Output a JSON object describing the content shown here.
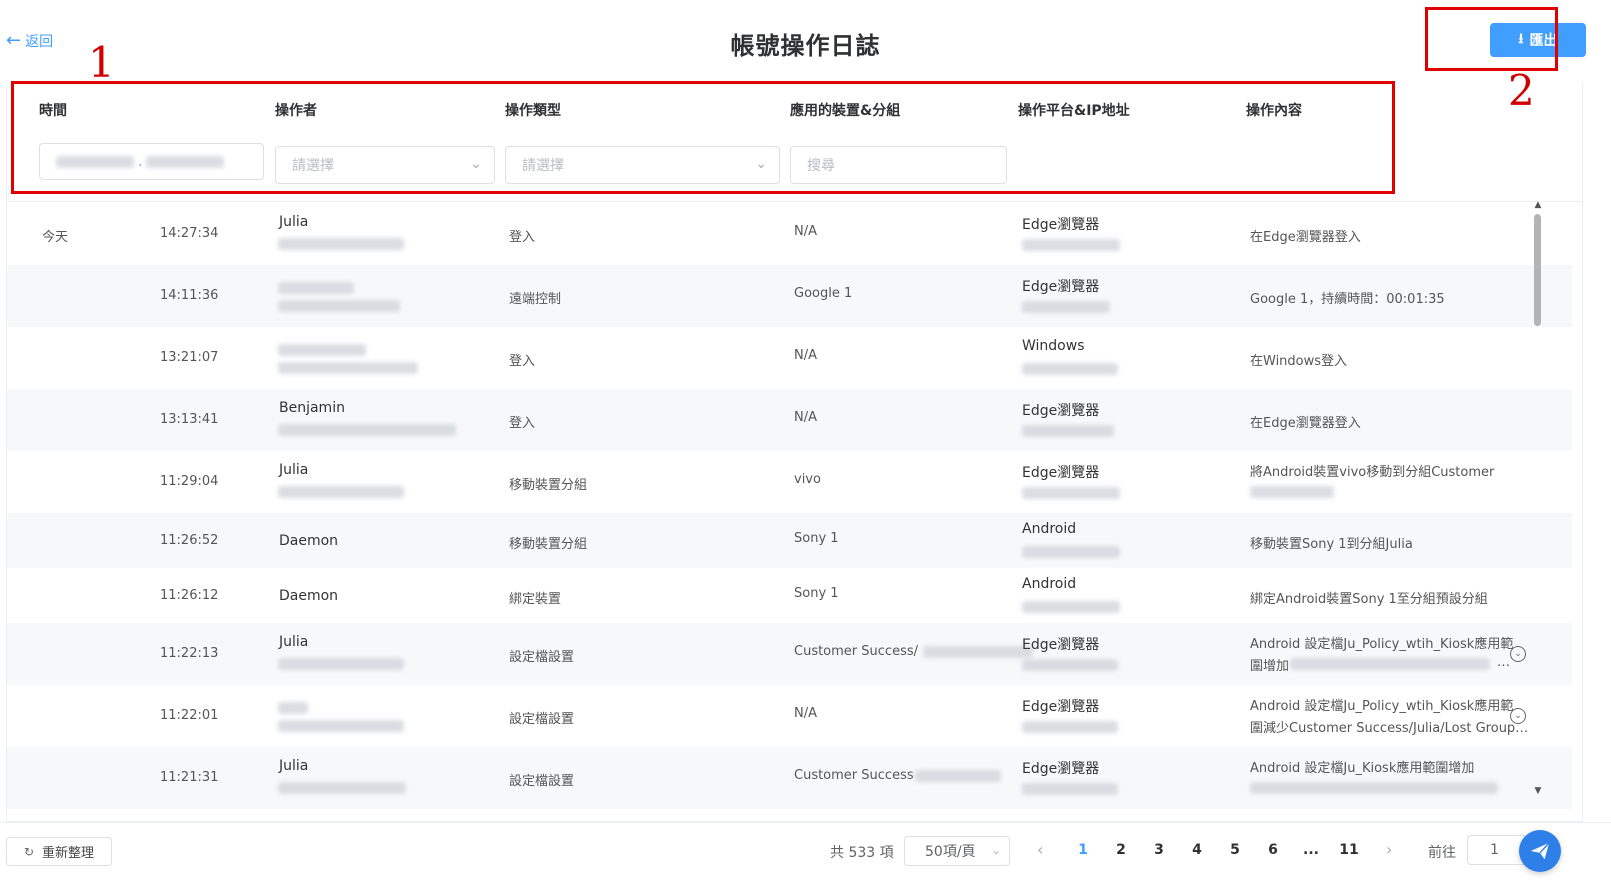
{
  "header": {
    "back_label": "返回",
    "title": "帳號操作日誌",
    "export_label": "匯出"
  },
  "annotations": [
    "1",
    "2"
  ],
  "columns": [
    "時間",
    "操作者",
    "操作類型",
    "應用的裝置&分組",
    "操作平台&IP地址",
    "操作內容"
  ],
  "filters": {
    "operator_placeholder": "請選擇",
    "type_placeholder": "請選擇",
    "search_placeholder": "搜尋"
  },
  "rows": [
    {
      "date": "今天",
      "time": "14:27:34",
      "operator": "Julia",
      "type": "登入",
      "device": "N/A",
      "platform": "Edge瀏覽器",
      "content": "在Edge瀏覽器登入"
    },
    {
      "date": "",
      "time": "14:11:36",
      "operator": "",
      "type": "遠端控制",
      "device": "Google 1",
      "platform": "Edge瀏覽器",
      "content": "Google 1，持續時間：00:01:35"
    },
    {
      "date": "",
      "time": "13:21:07",
      "operator": "",
      "type": "登入",
      "device": "N/A",
      "platform": "Windows",
      "content": "在Windows登入"
    },
    {
      "date": "",
      "time": "13:13:41",
      "operator": "Benjamin",
      "type": "登入",
      "device": "N/A",
      "platform": "Edge瀏覽器",
      "content": "在Edge瀏覽器登入"
    },
    {
      "date": "",
      "time": "11:29:04",
      "operator": "Julia",
      "type": "移動裝置分組",
      "device": "vivo",
      "platform": "Edge瀏覽器",
      "content": "將Android裝置vivo移動到分組Customer"
    },
    {
      "date": "",
      "time": "11:26:52",
      "operator": "Daemon",
      "type": "移動裝置分組",
      "device": "Sony 1",
      "platform": "Android",
      "content": "移動裝置Sony 1到分組Julia"
    },
    {
      "date": "",
      "time": "11:26:12",
      "operator": "Daemon",
      "type": "綁定裝置",
      "device": "Sony 1",
      "platform": "Android",
      "content": "綁定Android裝置Sony 1至分組預設分組"
    },
    {
      "date": "",
      "time": "11:22:13",
      "operator": "Julia",
      "type": "設定檔設置",
      "device": "Customer Success/",
      "platform": "Edge瀏覽器",
      "content": "Android 設定檔Ju_Policy_wtih_Kiosk應用範",
      "content2": "圍增加",
      "content2_tail": "…"
    },
    {
      "date": "",
      "time": "11:22:01",
      "operator": "",
      "type": "設定檔設置",
      "device": "N/A",
      "platform": "Edge瀏覽器",
      "content": "Android 設定檔Ju_Policy_wtih_Kiosk應用範",
      "content2": "圍減少Customer Success/Julia/Lost Group…"
    },
    {
      "date": "",
      "time": "11:21:31",
      "operator": "Julia",
      "type": "設定檔設置",
      "device": "Customer Success",
      "platform": "Edge瀏覽器",
      "content": "Android 設定檔Ju_Kiosk應用範圍增加"
    }
  ],
  "footer": {
    "refresh_label": "重新整理",
    "total_label": "共 533 項",
    "page_size": "50項/頁",
    "pages": [
      "1",
      "2",
      "3",
      "4",
      "5",
      "6",
      "...",
      "11"
    ],
    "goto_label": "前往",
    "goto_value": "1"
  }
}
